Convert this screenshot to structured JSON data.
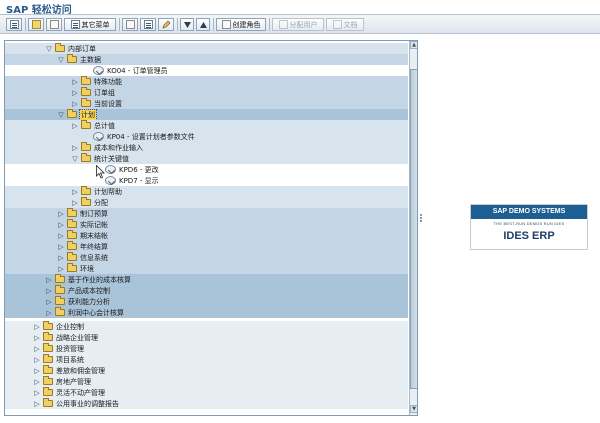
{
  "window": {
    "title": "SAP 轻松访问"
  },
  "toolbar": {
    "other_menu": "其它菜单",
    "create_role": "创建角色",
    "assign_user": "分配用户",
    "documentation": "文档"
  },
  "tree": [
    {
      "label": "内部订单",
      "kind": "folder",
      "toggle": "open"
    },
    {
      "label": "主数据",
      "kind": "folder",
      "toggle": "open"
    },
    {
      "label": "KO04 - 订单管理员",
      "kind": "tx",
      "toggle": ""
    },
    {
      "label": "特殊功能",
      "kind": "folder",
      "toggle": "closed"
    },
    {
      "label": "订单组",
      "kind": "folder",
      "toggle": "closed"
    },
    {
      "label": "当前设置",
      "kind": "folder",
      "toggle": "closed"
    },
    {
      "label": "计划",
      "kind": "folder",
      "toggle": "open",
      "selected": true
    },
    {
      "label": "总计值",
      "kind": "folder",
      "toggle": "closed"
    },
    {
      "label": "KP04 - 设置计划者参数文件",
      "kind": "tx",
      "toggle": ""
    },
    {
      "label": "成本和作业输入",
      "kind": "folder",
      "toggle": "closed"
    },
    {
      "label": "统计关键值",
      "kind": "folder",
      "toggle": "open"
    },
    {
      "label": "KPD6 - 更改",
      "kind": "tx",
      "toggle": ""
    },
    {
      "label": "KPD7 - 显示",
      "kind": "tx",
      "toggle": ""
    },
    {
      "label": "计划帮助",
      "kind": "folder",
      "toggle": "closed"
    },
    {
      "label": "分配",
      "kind": "folder",
      "toggle": "closed"
    },
    {
      "label": "制订预算",
      "kind": "folder",
      "toggle": "closed"
    },
    {
      "label": "实际记帐",
      "kind": "folder",
      "toggle": "closed"
    },
    {
      "label": "期末结帐",
      "kind": "folder",
      "toggle": "closed"
    },
    {
      "label": "年终结算",
      "kind": "folder",
      "toggle": "closed"
    },
    {
      "label": "信息系统",
      "kind": "folder",
      "toggle": "closed"
    },
    {
      "label": "环境",
      "kind": "folder",
      "toggle": "closed"
    },
    {
      "label": "基于作业的成本核算",
      "kind": "folder",
      "toggle": "closed"
    },
    {
      "label": "产品成本控制",
      "kind": "folder",
      "toggle": "closed"
    },
    {
      "label": "获利能力分析",
      "kind": "folder",
      "toggle": "closed"
    },
    {
      "label": "利润中心会计核算",
      "kind": "folder",
      "toggle": "closed"
    },
    {
      "label": "企业控制",
      "kind": "folder",
      "toggle": "closed"
    },
    {
      "label": "战略企业管理",
      "kind": "folder",
      "toggle": "closed"
    },
    {
      "label": "投资管理",
      "kind": "folder",
      "toggle": "closed"
    },
    {
      "label": "项目系统",
      "kind": "folder",
      "toggle": "closed"
    },
    {
      "label": "差旅和佣金管理",
      "kind": "folder",
      "toggle": "closed"
    },
    {
      "label": "房地产管理",
      "kind": "folder",
      "toggle": "closed"
    },
    {
      "label": "灵活不动产管理",
      "kind": "folder",
      "toggle": "closed"
    },
    {
      "label": "公用事业的调整报告",
      "kind": "folder",
      "toggle": "closed"
    }
  ],
  "logo": {
    "brand": "SAP DEMO SYSTEMS",
    "tagline": "THE BEST-RUN DEMOS RUN IDES",
    "product": "IDES ERP"
  },
  "colors": {
    "title": "#2a5a8a",
    "selected_highlight": "#f6d35a",
    "logo_band": "#1d5f92"
  }
}
